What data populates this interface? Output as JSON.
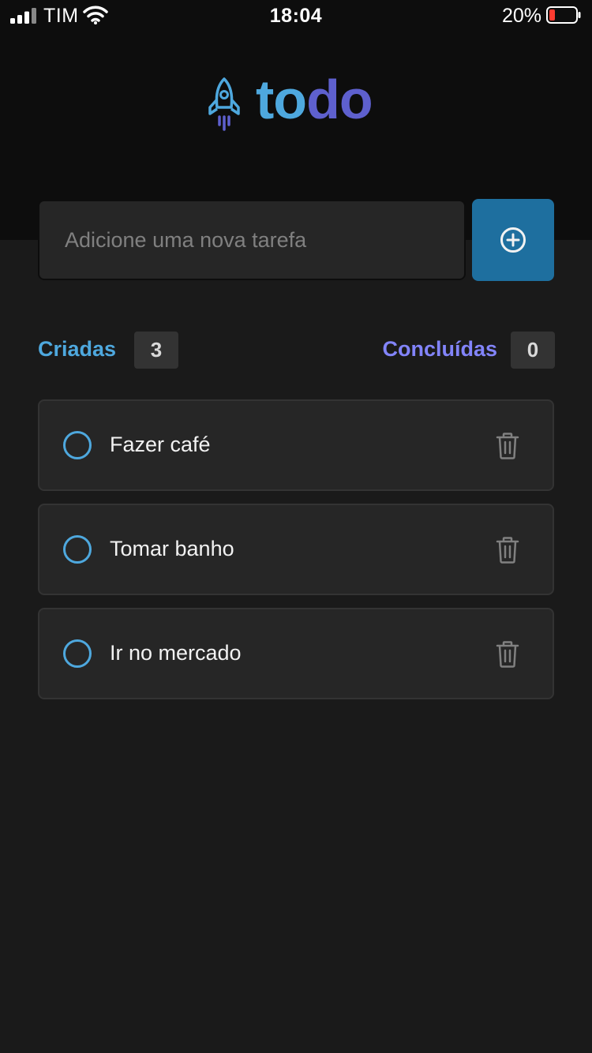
{
  "status_bar": {
    "carrier": "TIM",
    "time": "18:04",
    "battery_percent": "20%",
    "icons": [
      "signal-icon",
      "wifi-icon",
      "battery-icon"
    ]
  },
  "logo": {
    "part1": "to",
    "part2": "do",
    "icon": "rocket-icon"
  },
  "new_task": {
    "placeholder": "Adicione uma nova tarefa",
    "value": "",
    "add_icon": "plus-circle-icon"
  },
  "counters": {
    "created_label": "Criadas",
    "created_count": "3",
    "done_label": "Concluídas",
    "done_count": "0"
  },
  "tasks": [
    {
      "title": "Fazer café",
      "done": false
    },
    {
      "title": "Tomar banho",
      "done": false
    },
    {
      "title": "Ir no mercado",
      "done": false
    }
  ],
  "colors": {
    "blue": "#4ea8de",
    "purple": "#5e60ce",
    "purple_light": "#8284fa",
    "button_blue": "#1e6f9f",
    "background": "#1a1a1a",
    "header": "#0d0d0d",
    "card": "#262626"
  }
}
